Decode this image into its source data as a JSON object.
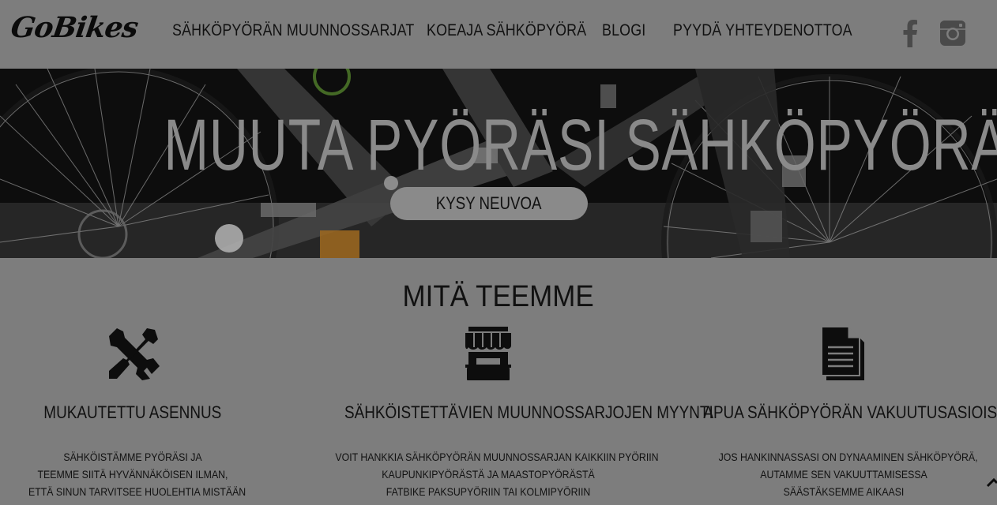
{
  "header": {
    "logo": "GoBikes",
    "nav": [
      {
        "label": "SÄHKÖPYÖRÄN MUUNNOSSARJAT"
      },
      {
        "label": "KOEAJA SÄHKÖPYÖRÄ"
      },
      {
        "label": "BLOGI"
      },
      {
        "label": "PYYDÄ YHTEYDENOTTOA"
      }
    ],
    "social": [
      {
        "icon": "facebook-icon"
      },
      {
        "icon": "instagram-icon"
      }
    ]
  },
  "hero": {
    "title": "MUUTA PYÖRÄSI SÄHKÖPYÖRÄKSI",
    "button": "KYSY NEUVOA"
  },
  "services": {
    "title": "MITÄ TEEMME",
    "items": [
      {
        "icon": "tools-icon",
        "title": "MUKAUTETTU ASENNUS",
        "lines": [
          "SÄHKÖISTÄMME PYÖRÄSI JA",
          "TEEMME SIITÄ HYVÄNNÄKÖISEN ILMAN,",
          "ETTÄ SINUN TARVITSEE HUOLEHTIA MISTÄÄN"
        ]
      },
      {
        "icon": "store-icon",
        "title": "SÄHKÖISTETTÄVIEN MUUNNOSSARJOJEN MYYNTI",
        "lines": [
          "VOIT HANKKIA SÄHKÖPYÖRÄN MUUNNOSSARJAN KAIKKIIN PYÖRIIN",
          "KAUPUNKIPYÖRÄSTÄ JA MAASTOPYÖRÄSTÄ",
          "FATBIKE PAKSUPYÖRIIN TAI KOLMIPYÖRIIN"
        ]
      },
      {
        "icon": "document-icon",
        "title": "APUA SÄHKÖPYÖRÄN VAKUUTUSASIOISSA",
        "lines": [
          "JOS HANKINNASSASI ON DYNAAMINEN SÄHKÖPYÖRÄ,",
          "AUTAMME SEN VAKUUTTAMISESSA",
          "SÄÄSTÄKSEMME AIKAASI"
        ]
      }
    ]
  },
  "colors": {
    "overlay_gray": "#7d7d7d",
    "text_dark": "#111111",
    "hero_text": "#8a8a8a"
  }
}
